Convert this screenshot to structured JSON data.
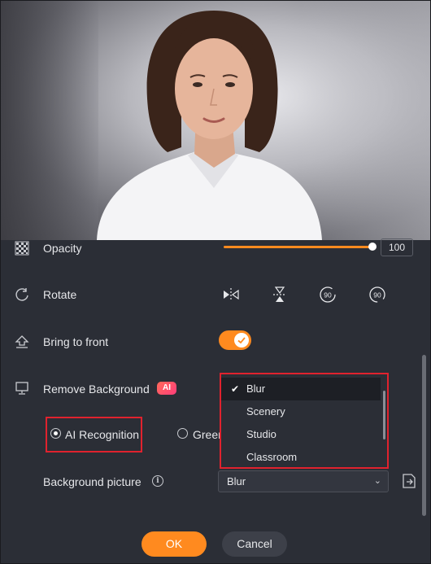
{
  "preview": {
    "image": "portrait of woman in white shirt with blurred background"
  },
  "opacity": {
    "label": "Opacity",
    "value": "100",
    "slider_fraction": 1.0
  },
  "rotate": {
    "label": "Rotate",
    "icons": [
      "flip-horizontal-icon",
      "flip-vertical-icon",
      "rotate-left-90-icon",
      "rotate-right-90-icon"
    ]
  },
  "bring_to_front": {
    "label": "Bring to front",
    "enabled": true
  },
  "remove_background": {
    "label": "Remove Background",
    "badge": "AI",
    "options": [
      {
        "label": "AI Recognition",
        "selected": true
      },
      {
        "label": "Green",
        "selected": false
      }
    ]
  },
  "dropdown": {
    "items": [
      "Blur",
      "Scenery",
      "Studio",
      "Classroom"
    ],
    "selected": "Blur"
  },
  "background_picture": {
    "label": "Background picture",
    "value": "Blur"
  },
  "buttons": {
    "ok": "OK",
    "cancel": "Cancel"
  },
  "colors": {
    "accent": "#ff8a1f",
    "highlight": "#e0222e",
    "panel": "#2b2e36"
  }
}
